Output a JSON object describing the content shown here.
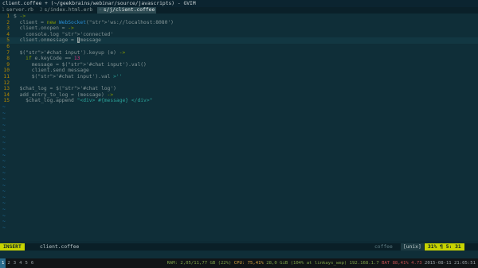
{
  "window": {
    "title": "client.coffee + (~/geekbrains/webinar/source/javascripts) - GVIM"
  },
  "tabs": [
    {
      "num": "1",
      "label": "server.rb",
      "active": false
    },
    {
      "num": "2",
      "label": "s/index.html.erb",
      "active": false
    },
    {
      "num": "+",
      "label": "s/j/client.coffee",
      "active": true
    }
  ],
  "editor": {
    "lines": [
      {
        "n": "1",
        "text": "$ ->"
      },
      {
        "n": "2",
        "text": "  client = new WebSocket('ws://localhost:8080')"
      },
      {
        "n": "3",
        "text": "  client.onopen = ->"
      },
      {
        "n": "4",
        "text": "    console.log 'connected'"
      },
      {
        "n": "5",
        "text": "  client.onmessage = (message"
      },
      {
        "n": "6",
        "text": ""
      },
      {
        "n": "7",
        "text": "  $('#chat input').keyup (e) ->"
      },
      {
        "n": "8",
        "text": "    if e.keyCode == 13"
      },
      {
        "n": "9",
        "text": "      message = $('#chat input').val()"
      },
      {
        "n": "10",
        "text": "      client.send message"
      },
      {
        "n": "11",
        "text": "      $('#chat input').val ''"
      },
      {
        "n": "12",
        "text": ""
      },
      {
        "n": "13",
        "text": "  $chat_log = $('#chat log')"
      },
      {
        "n": "14",
        "text": "  add_entry_to_log = (message) ->"
      },
      {
        "n": "15",
        "text": "    $chat_log.append \"<div> #{message} </div>\""
      }
    ],
    "tilde": "~",
    "tilde_count": 21
  },
  "statusline": {
    "mode": "INSERT",
    "file": "client.coffee",
    "filetype": "coffee",
    "format": "[unix]",
    "percent": "31% ¶",
    "position": "5: 31"
  },
  "panel": {
    "workspaces": [
      "1",
      "2",
      "3",
      "4",
      "5",
      "6"
    ],
    "active_workspace": "1",
    "ram_label": "RAM:",
    "ram": "2,05/11,77 GB (22%)",
    "cpu_label": "CPU:",
    "cpu": "75,41%",
    "disk": "28,0 GiB",
    "wifi": "(104% at linkays_wep) 192.168.1.7",
    "battery": "BAT 88,41% 4.73",
    "datetime": "2015-08-11 21:05:51"
  }
}
